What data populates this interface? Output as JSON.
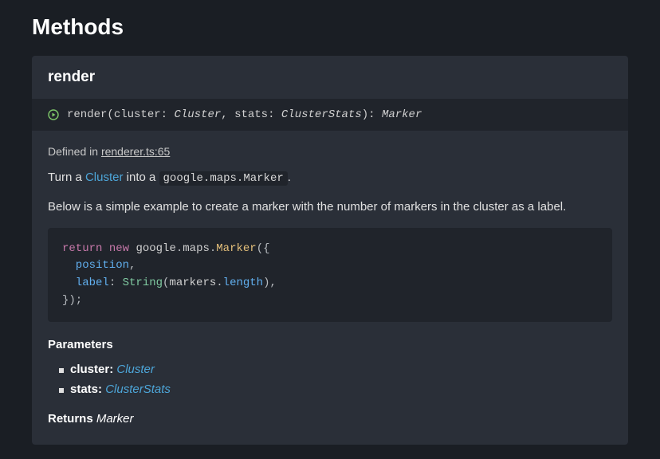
{
  "section_title": "Methods",
  "method": {
    "name": "render",
    "signature": {
      "fn": "render",
      "params": [
        {
          "name": "cluster",
          "type": "Cluster"
        },
        {
          "name": "stats",
          "type": "ClusterStats"
        }
      ],
      "return_type": "Marker"
    },
    "defined_in_label": "Defined in ",
    "defined_in_link": "renderer.ts:65",
    "description_parts": {
      "p1_a": "Turn a ",
      "p1_link": "Cluster",
      "p1_b": " into a ",
      "p1_code": "google.maps.Marker",
      "p1_c": ".",
      "p2": "Below is a simple example to create a marker with the number of markers in the cluster as a label."
    },
    "code_example": {
      "l1_a": "return",
      "l1_b": " ",
      "l1_c": "new",
      "l1_d": " google",
      "l1_e": ".",
      "l1_f": "maps",
      "l1_g": ".",
      "l1_h": "Marker",
      "l1_i": "({",
      "l2_a": "  position",
      "l2_b": ",",
      "l3_a": "  label",
      "l3_b": ": ",
      "l3_c": "String",
      "l3_d": "(",
      "l3_e": "markers",
      "l3_f": ".",
      "l3_g": "length",
      "l3_h": "),",
      "l4": "});"
    },
    "parameters_heading": "Parameters",
    "parameters": [
      {
        "name": "cluster:",
        "type": "Cluster"
      },
      {
        "name": "stats:",
        "type": "ClusterStats"
      }
    ],
    "returns_label": "Returns ",
    "returns_type": "Marker"
  }
}
